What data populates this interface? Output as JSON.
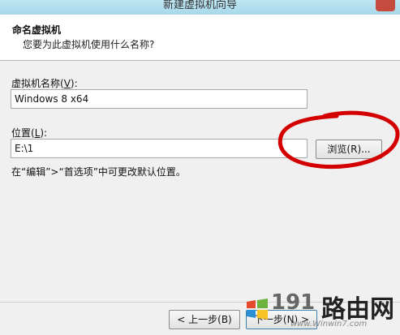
{
  "window": {
    "title": "新建虚拟机向导"
  },
  "header": {
    "title": "命名虚拟机",
    "subtitle": "您要为此虚拟机使用什么名称?"
  },
  "name_field": {
    "label_prefix": "虚拟机名称(",
    "label_key": "V",
    "label_suffix": "):",
    "value": "Windows 8 x64"
  },
  "location_field": {
    "label_prefix": "位置(",
    "label_key": "L",
    "label_suffix": "):",
    "value": "E:\\1"
  },
  "browse_button": {
    "label": "浏览(R)..."
  },
  "hint": "在“编辑”>“首选项”中可更改默认位置。",
  "footer": {
    "back_label": "< 上一步(B)",
    "next_label": "下一步(N) >"
  },
  "watermark": {
    "number": "191",
    "text": "路由网",
    "url": "www.Winwin7.com"
  },
  "colors": {
    "annotation": "#d40000"
  }
}
